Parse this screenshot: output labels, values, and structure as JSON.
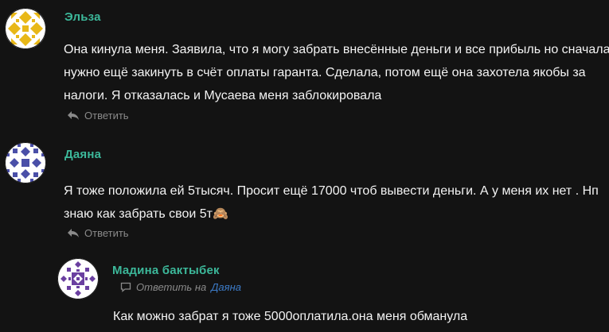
{
  "comments": [
    {
      "author": "Эльза",
      "lines": [
        "Она кинула меня. Заявила, что я могу забрать внесённые деньги и все прибыль но сначала",
        "нужно ещё закинуть в счёт оплаты гаранта. Сделала, потом ещё она захотела якобы за",
        "налоги. Я отказалась и Мусаева меня заблокировала"
      ],
      "reply_label": "Ответить",
      "avatar_color": "#e8b818"
    },
    {
      "author": "Даяна",
      "lines": [
        "Я тоже положила ей 5тысяч. Просит ещё 17000 чтоб вывести деньги. А у меня их нет . Нп",
        "знаю как забрать свои 5т🙈"
      ],
      "reply_label": "Ответить",
      "avatar_color": "#4a4fa8"
    },
    {
      "author": "Мадина бактыбек",
      "reply_prefix": "Ответить на",
      "reply_target": "Даяна",
      "lines": [
        "Как можно забрат я тоже 5000оплатила.она меня обманула"
      ],
      "avatar_color": "#6a3fa0"
    }
  ],
  "colors": {
    "background": "#131313",
    "author": "#3cb89a",
    "link": "#3d7cc9",
    "muted": "#8a8a8a"
  }
}
